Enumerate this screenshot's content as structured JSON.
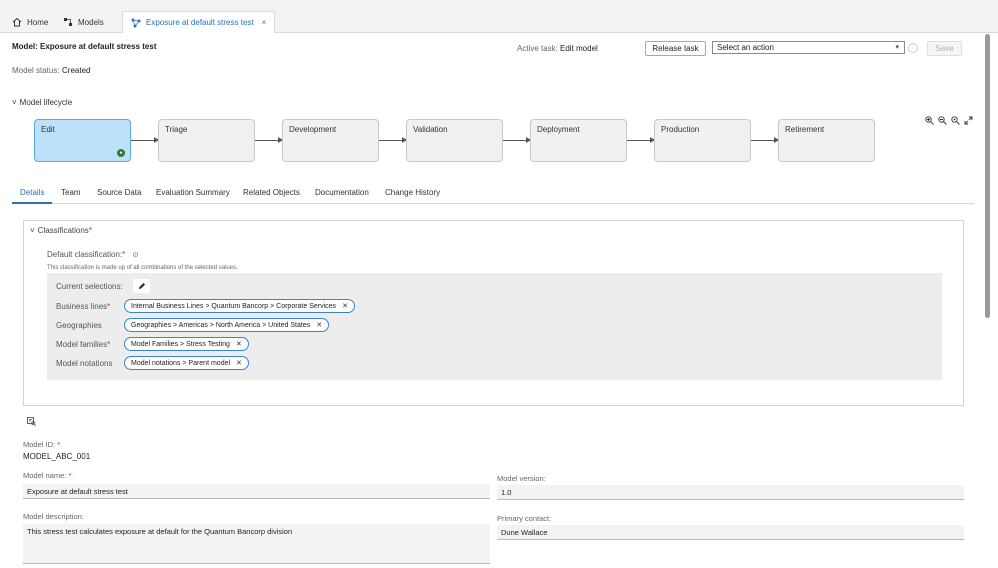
{
  "top_tabs": {
    "home": "Home",
    "models": "Models",
    "current": "Exposure at default stress test",
    "close": "×"
  },
  "header": {
    "model_title": "Model: Exposure at default stress test",
    "status_label": "Model status:",
    "status_value": "Created",
    "active_task_label": "Active task:",
    "active_task_value": "Edit model",
    "release_task": "Release task",
    "action_placeholder": "Select an action",
    "save": "Save"
  },
  "lifecycle": {
    "toggle_label": "Model lifecycle",
    "stages": [
      "Edit",
      "Triage",
      "Development",
      "Validation",
      "Deployment",
      "Production",
      "Retirement"
    ],
    "current_stage": "Edit"
  },
  "tabs": [
    "Details",
    "Team",
    "Source Data",
    "Evaluation Summary",
    "Related Objects",
    "Documentation",
    "Change History"
  ],
  "active_tab": "Details",
  "classifications": {
    "title": "Classifications",
    "default_label": "Default classification:",
    "hint": "This classification is made up of all combinations of the selected values.",
    "current_selections": "Current selections:",
    "rows": [
      {
        "label": "Business lines",
        "required": true,
        "chip": "Internal Business Lines > Quantum Bancorp > Corporate Services"
      },
      {
        "label": "Geographies",
        "required": false,
        "chip": "Geographies > Americas > North America > United States"
      },
      {
        "label": "Model families",
        "required": true,
        "chip": "Model Families > Stress Testing"
      },
      {
        "label": "Model notations",
        "required": false,
        "chip": "Model notations > Parent model"
      }
    ]
  },
  "form": {
    "model_id_label": "Model ID:",
    "model_id_value": "MODEL_ABC_001",
    "model_name_label": "Model name:",
    "model_name_value": "Exposure at default stress test",
    "model_version_label": "Model version:",
    "model_version_value": "1.0",
    "model_description_label": "Model description:",
    "model_description_value": "This stress test calculates exposure at default for the Quantum Bancorp division",
    "primary_contact_label": "Primary contact:",
    "primary_contact_value": "Dune Wallace"
  }
}
